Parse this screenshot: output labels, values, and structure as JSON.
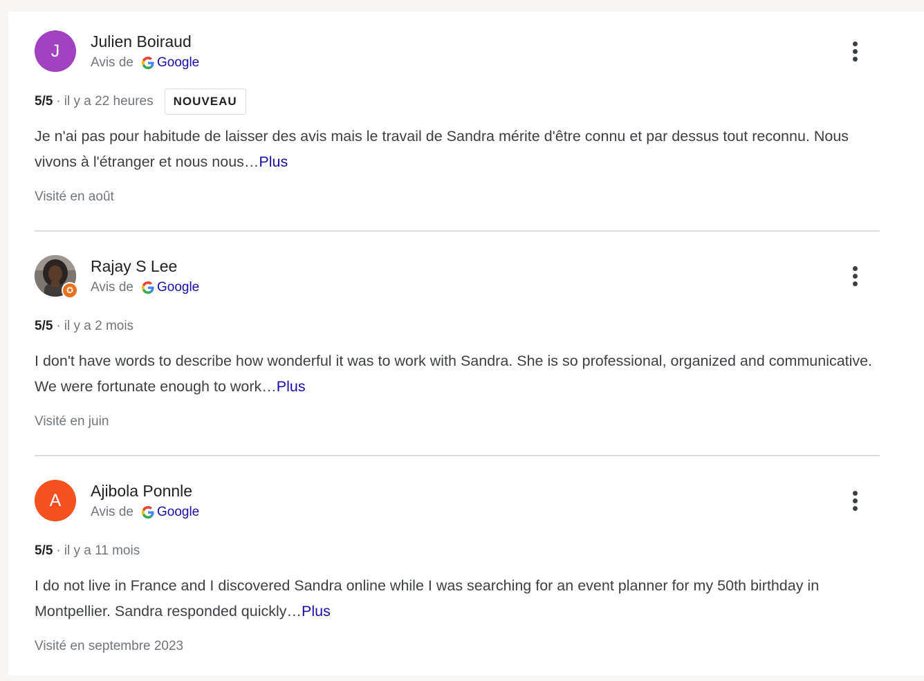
{
  "reviews": [
    {
      "author": "Julien Boiraud",
      "avatar_letter": "J",
      "avatar_color": "#a142c0",
      "source_prefix": "Avis de",
      "source_name": "Google",
      "rating": "5/5",
      "separator": "·",
      "time_ago": "il y a 22 heures",
      "badge": "NOUVEAU",
      "text": "Je n'ai pas pour habitude de laisser des avis mais le travail de Sandra mérite d'être connu et par dessus tout reconnu. Nous vivons à l'étranger et nous nous…",
      "more_label": "Plus",
      "visit": "Visité en août"
    },
    {
      "author": "Rajay S Lee",
      "avatar_type": "photo",
      "local_guide_icon": "star-badge-icon",
      "source_prefix": "Avis de",
      "source_name": "Google",
      "rating": "5/5",
      "separator": "·",
      "time_ago": "il y a 2 mois",
      "text": "I don't have words to describe how wonderful it was to work with Sandra. She is so professional, organized and communicative. We were fortunate enough to work…",
      "more_label": "Plus",
      "visit": "Visité en juin"
    },
    {
      "author": "Ajibola Ponnle",
      "avatar_letter": "A",
      "avatar_color": "#f4511e",
      "source_prefix": "Avis de",
      "source_name": "Google",
      "rating": "5/5",
      "separator": "·",
      "time_ago": "il y a 11 mois",
      "text": "I do not live in France and I discovered Sandra online while I was searching for an event planner for my 50th birthday in Montpellier. Sandra responded quickly…",
      "more_label": "Plus",
      "visit": "Visité en septembre 2023"
    }
  ],
  "icons": {
    "menu": "more-vert-icon",
    "source_logo": "google-g-icon"
  }
}
